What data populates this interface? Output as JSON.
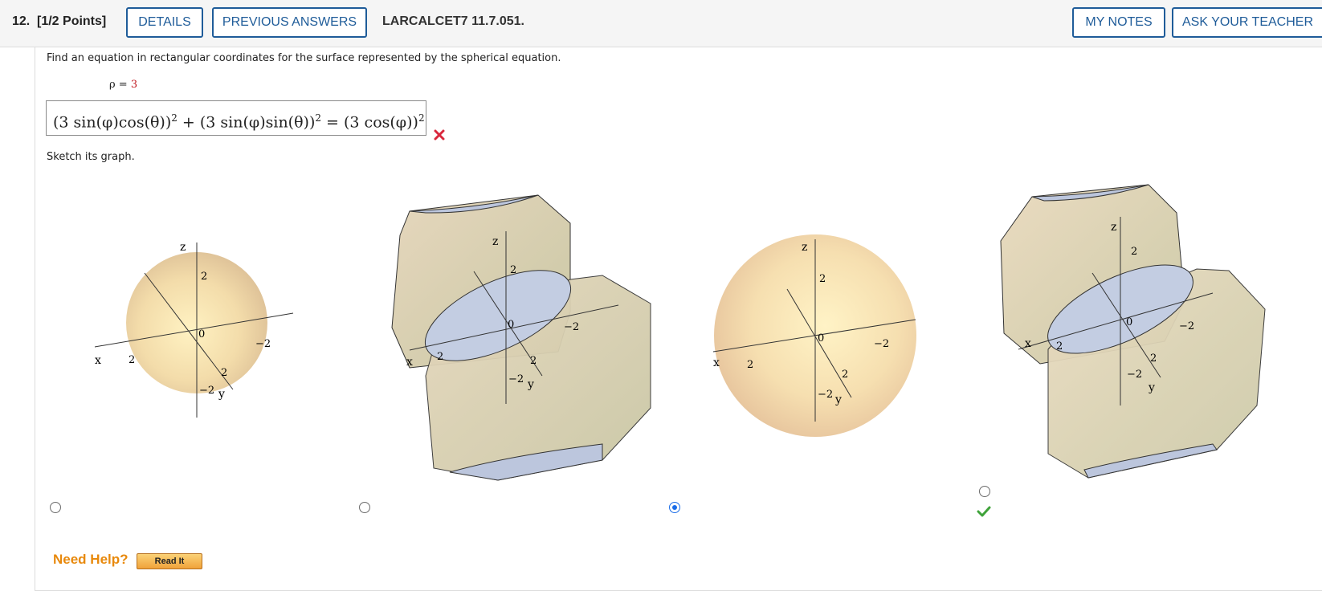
{
  "header": {
    "question_number": "12.",
    "points": "[1/2 Points]",
    "details_button": "DETAILS",
    "previous_answers_button": "PREVIOUS ANSWERS",
    "source": "LARCALCET7 11.7.051.",
    "my_notes_button": "MY NOTES",
    "ask_teacher_button": "ASK YOUR TEACHER"
  },
  "question": {
    "prompt": "Find an equation in rectangular coordinates for the surface represented by the spherical equation.",
    "given_lhs": "ρ = ",
    "given_rhs": "3",
    "answer_parts": [
      "(3 sin(φ)cos(θ))",
      "2",
      " + (3 sin(φ)sin(θ))",
      "2",
      " = (3 cos(φ))",
      "2"
    ],
    "answer_status": "incorrect",
    "sketch_prompt": "Sketch its graph."
  },
  "graph_options": [
    {
      "label": "sphere-small",
      "selected": false,
      "correct": false
    },
    {
      "label": "two-cylinders",
      "selected": false,
      "correct": false
    },
    {
      "label": "sphere-large",
      "selected": true,
      "correct": true
    },
    {
      "label": "two-cylinders-alt",
      "selected": false,
      "correct": false
    }
  ],
  "graph_axis_labels": {
    "x": "x",
    "y": "y",
    "z": "z",
    "tick_pos": "2",
    "tick_neg": "−2",
    "origin": "0"
  },
  "help": {
    "need_help": "Need Help?",
    "read_it_button": "Read It"
  },
  "colors": {
    "accent": "#1f5c99",
    "error": "#d9283d",
    "correct": "#3fa33a",
    "help": "#e8890c"
  }
}
